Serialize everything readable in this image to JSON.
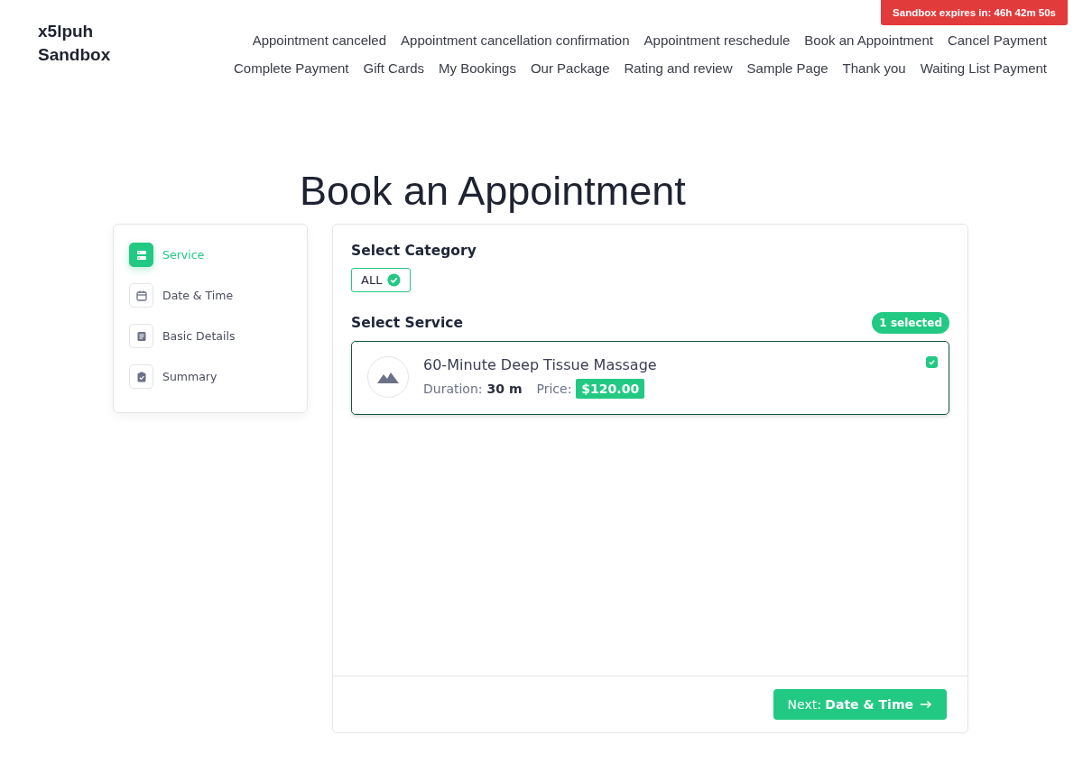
{
  "site": {
    "title": "x5lpuh Sandbox"
  },
  "nav_rows": [
    [
      "Appointment canceled",
      "Appointment cancellation confirmation",
      "Appointment reschedule",
      "Book an Appointment",
      "Cancel Payment"
    ],
    [
      "Complete Payment",
      "Gift Cards",
      "My Bookings",
      "Our Package",
      "Rating and review",
      "Sample Page",
      "Thank you",
      "Waiting List Payment"
    ]
  ],
  "sandbox_banner": "Sandbox expires in: 46h 42m 50s",
  "page_title": "Book an Appointment",
  "steps": [
    {
      "label": "Service",
      "kind": "service",
      "selected": true
    },
    {
      "label": "Date & Time",
      "kind": "calendar",
      "selected": false
    },
    {
      "label": "Basic Details",
      "kind": "details",
      "selected": false
    },
    {
      "label": "Summary",
      "kind": "summary",
      "selected": false
    }
  ],
  "category_heading": "Select Category",
  "categories": [
    {
      "label": "ALL",
      "selected": true
    }
  ],
  "service_heading": "Select Service",
  "selected_count": "1 selected",
  "services": [
    {
      "name": "60-Minute Deep Tissue Massage",
      "duration_label": "Duration:",
      "duration": "30 m",
      "price_label": "Price:",
      "price": "$120.00",
      "checked": true
    }
  ],
  "next_button": "Next: **Date & Time**"
}
